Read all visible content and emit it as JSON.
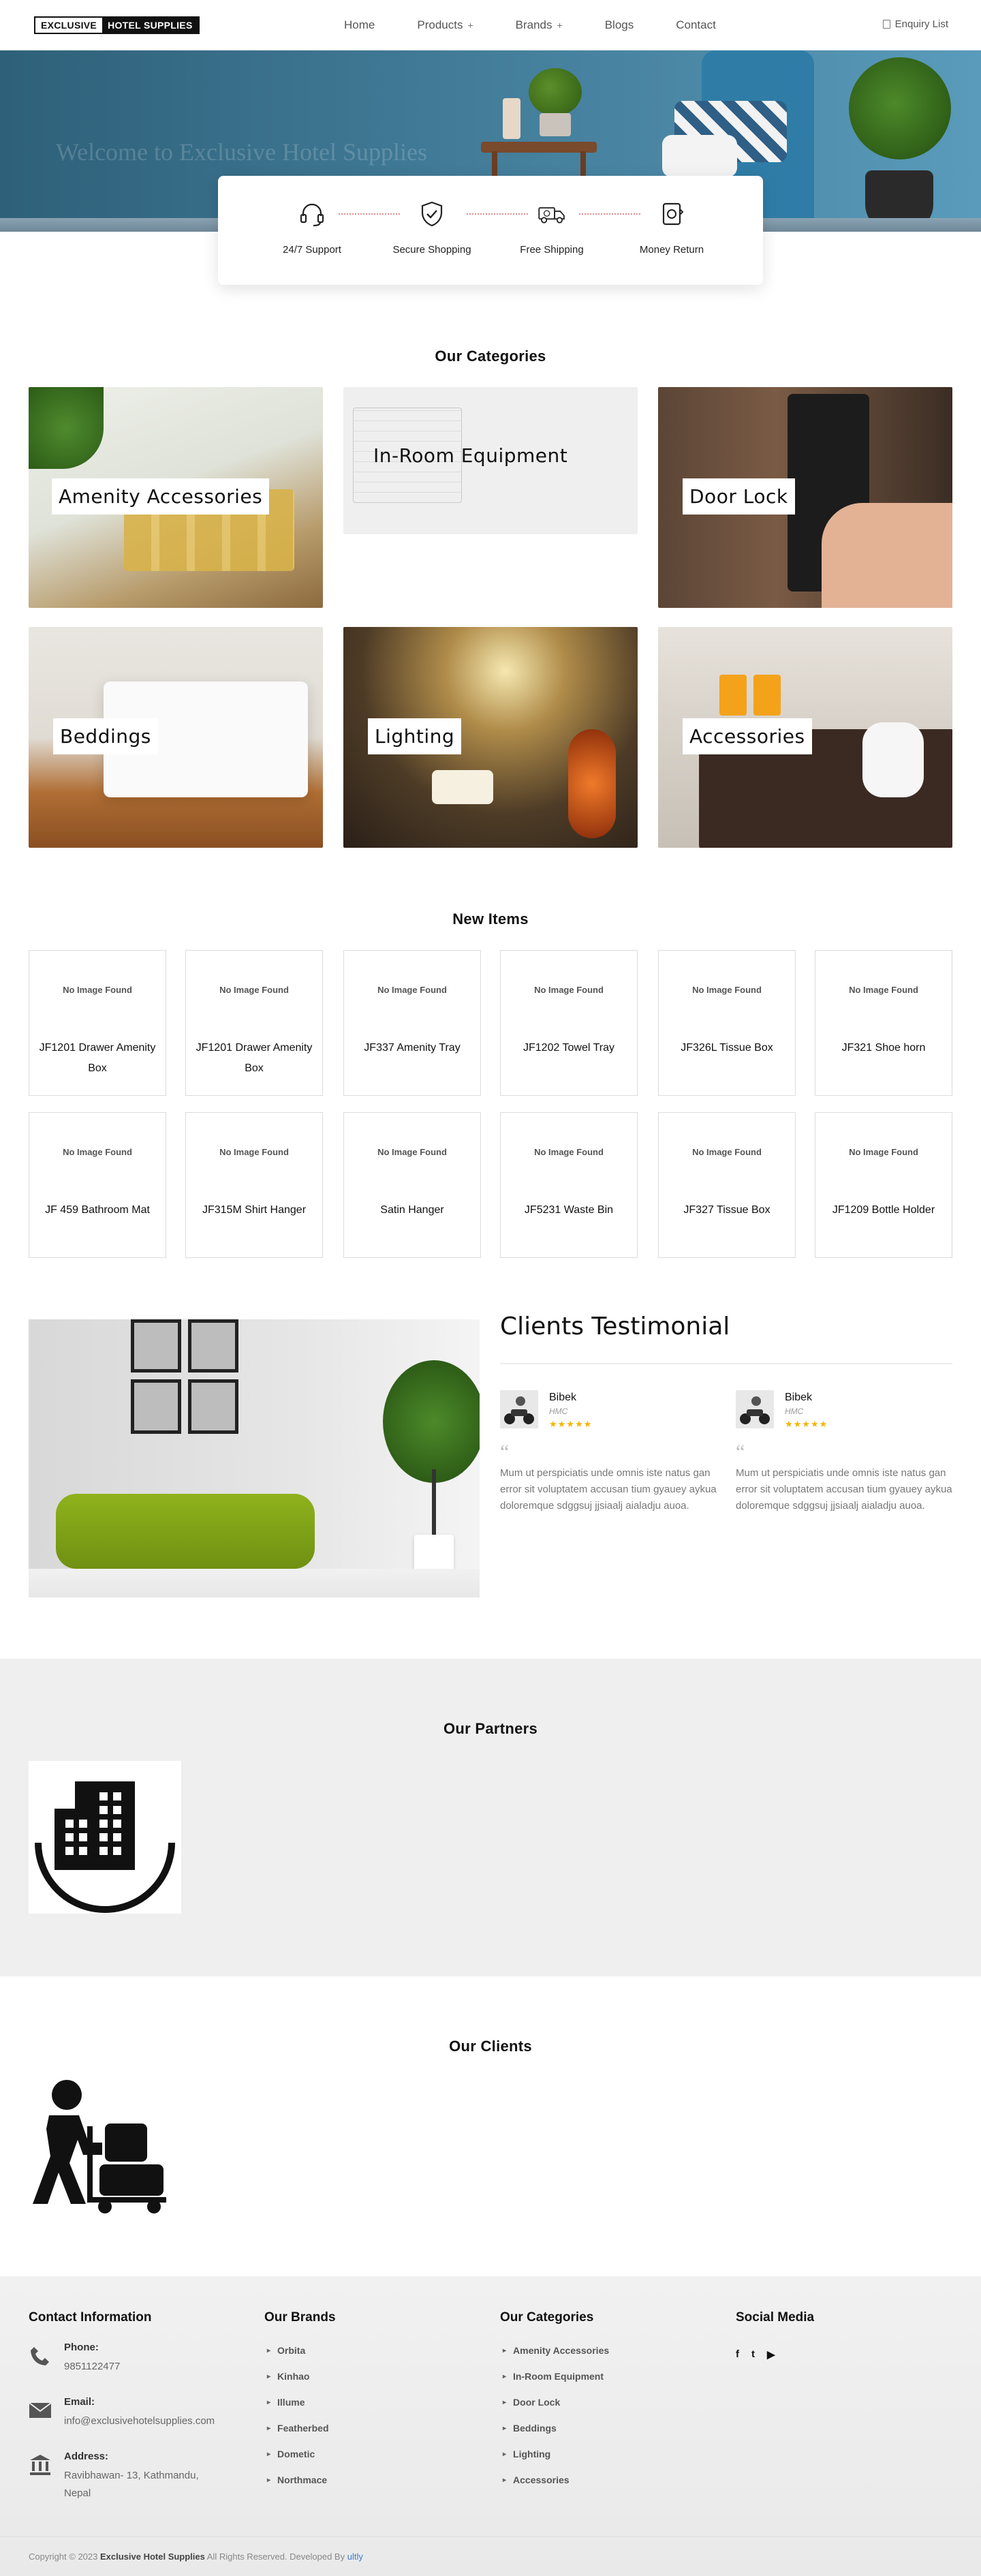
{
  "header": {
    "logo": {
      "part1": "EXCLUSIVE",
      "part2": "HOTEL SUPPLIES"
    },
    "nav": [
      {
        "label": "Home",
        "has_submenu": false
      },
      {
        "label": "Products",
        "has_submenu": true
      },
      {
        "label": "Brands",
        "has_submenu": true
      },
      {
        "label": "Blogs",
        "has_submenu": false
      },
      {
        "label": "Contact",
        "has_submenu": false
      }
    ],
    "submenu_marker": "+",
    "enquiry": "Enquiry List"
  },
  "hero": {
    "title": "Welcome to Exclusive Hotel Supplies"
  },
  "features": [
    {
      "label": "24/7 Support",
      "icon": "headset-icon"
    },
    {
      "label": "Secure Shopping",
      "icon": "shield-check-icon"
    },
    {
      "label": "Free Shipping",
      "icon": "truck-icon"
    },
    {
      "label": "Money Return",
      "icon": "money-return-icon"
    }
  ],
  "categories": {
    "title": "Our Categories",
    "items": [
      {
        "label": "Amenity Accessories"
      },
      {
        "label": "In-Room Equipment"
      },
      {
        "label": "Door Lock"
      },
      {
        "label": "Beddings"
      },
      {
        "label": "Lighting"
      },
      {
        "label": "Accessories"
      }
    ]
  },
  "new_items": {
    "title": "New Items",
    "placeholder": "No Image Found",
    "items": [
      {
        "name": "JF1201 Drawer Amenity Box"
      },
      {
        "name": "JF1201 Drawer Amenity Box"
      },
      {
        "name": "JF337 Amenity Tray"
      },
      {
        "name": "JF1202 Towel Tray"
      },
      {
        "name": "JF326L Tissue Box"
      },
      {
        "name": "JF321 Shoe horn"
      },
      {
        "name": "JF 459 Bathroom Mat"
      },
      {
        "name": "JF315M Shirt Hanger"
      },
      {
        "name": "Satin Hanger"
      },
      {
        "name": "JF5231 Waste Bin"
      },
      {
        "name": "JF327 Tissue Box"
      },
      {
        "name": "JF1209 Bottle Holder"
      }
    ]
  },
  "testimonial": {
    "title": "Clients Testimonial",
    "quote_mark": "“",
    "items": [
      {
        "name": "Bibek",
        "role": "HMC",
        "stars": "★★★★★",
        "text": "Mum ut perspiciatis unde omnis iste natus gan error sit voluptatem accusan tium gyauey aykua doloremque sdggsuj jjsiaalj aialadju auoa."
      },
      {
        "name": "Bibek",
        "role": "HMC",
        "stars": "★★★★★",
        "text": "Mum ut perspiciatis unde omnis iste natus gan error sit voluptatem accusan tium gyauey aykua doloremque sdggsuj jjsiaalj aialadju auoa."
      }
    ]
  },
  "partners": {
    "title": "Our Partners"
  },
  "clients": {
    "title": "Our Clients"
  },
  "footer": {
    "contact": {
      "title": "Contact Information",
      "phone_label": "Phone:",
      "phone": "9851122477",
      "email_label": "Email:",
      "email": "info@exclusivehotelsupplies.com",
      "address_label": "Address:",
      "address": "Ravibhawan- 13, Kathmandu, Nepal"
    },
    "brands": {
      "title": "Our Brands",
      "items": [
        "Orbita",
        "Kinhao",
        "Illume",
        "Featherbed",
        "Dometic",
        "Northmace"
      ]
    },
    "categories": {
      "title": "Our Categories",
      "items": [
        "Amenity Accessories",
        "In-Room Equipment",
        "Door Lock",
        "Beddings",
        "Lighting",
        "Accessories"
      ]
    },
    "social": {
      "title": "Social Media",
      "icons": [
        "f",
        "t",
        "▶"
      ]
    },
    "copyright": {
      "prefix": "Copyright © 2023",
      "brand": "Exclusive Hotel Supplies",
      "suffix": "All Rights Reserved. Developed By",
      "dev": "ultly"
    }
  }
}
